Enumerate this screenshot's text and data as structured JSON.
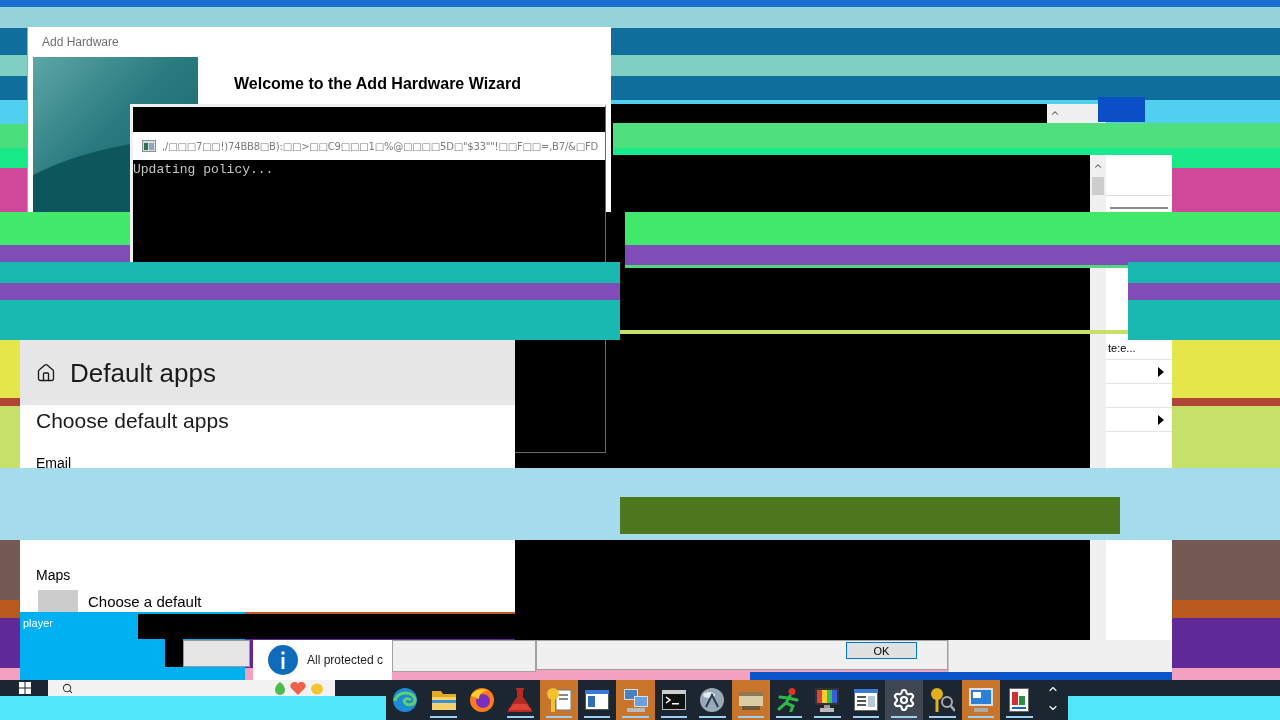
{
  "wizard_window": {
    "title": "Add Hardware",
    "heading": "Welcome to the Add Hardware Wizard"
  },
  "console_window": {
    "title": ",/□□□7□□!)74BB8□B):□□>□□C9□□□1□%@□□□□5D□\"$33\"\"!□□F□□=,B7/&□FD",
    "output": "Updating policy..."
  },
  "side_panel": {
    "rows": [
      {
        "kind": "text",
        "label": "te:e..."
      },
      {
        "kind": "submenu"
      },
      {
        "kind": "empty"
      },
      {
        "kind": "submenu"
      }
    ]
  },
  "settings_window": {
    "header": "Default apps",
    "heading": "Choose default apps",
    "sections": [
      {
        "label": "Email"
      },
      {
        "label": "Maps",
        "choice": "Choose a default"
      }
    ]
  },
  "media_tile": {
    "label": "player"
  },
  "notification": {
    "text": "All protected c"
  },
  "dialog": {
    "buttons": [
      "OK"
    ]
  },
  "taskbar": {
    "apps": [
      {
        "kind": "edge",
        "running": false,
        "flashing": false,
        "selected": false
      },
      {
        "kind": "folder",
        "running": true,
        "flashing": false,
        "selected": false
      },
      {
        "kind": "firefox",
        "running": false,
        "flashing": false,
        "selected": false
      },
      {
        "kind": "flask",
        "running": true,
        "flashing": false,
        "selected": false
      },
      {
        "kind": "certificate",
        "running": true,
        "flashing": true,
        "selected": false
      },
      {
        "kind": "window",
        "running": true,
        "flashing": false,
        "selected": false
      },
      {
        "kind": "network",
        "running": true,
        "flashing": true,
        "selected": false
      },
      {
        "kind": "terminal",
        "running": true,
        "flashing": false,
        "selected": false
      },
      {
        "kind": "ball",
        "running": true,
        "flashing": false,
        "selected": false
      },
      {
        "kind": "scanner",
        "running": true,
        "flashing": true,
        "selected": false
      },
      {
        "kind": "figure",
        "running": true,
        "flashing": false,
        "selected": false
      },
      {
        "kind": "monitor",
        "running": true,
        "flashing": false,
        "selected": false
      },
      {
        "kind": "list_window",
        "running": true,
        "flashing": false,
        "selected": false
      },
      {
        "kind": "gear",
        "running": true,
        "flashing": false,
        "selected": true
      },
      {
        "kind": "key",
        "running": true,
        "flashing": false,
        "selected": false
      },
      {
        "kind": "screen",
        "running": true,
        "flashing": true,
        "selected": false
      },
      {
        "kind": "font",
        "running": true,
        "flashing": false,
        "selected": false
      }
    ]
  }
}
